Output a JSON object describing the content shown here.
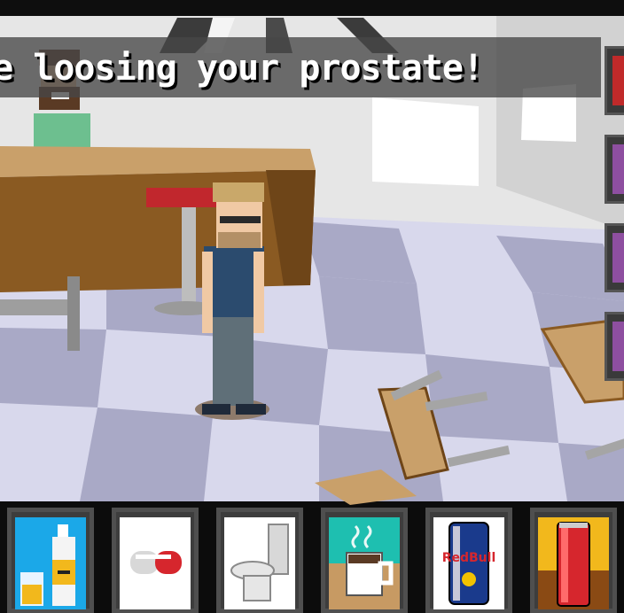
{
  "dialog": {
    "text": "re loosing your prostate!"
  },
  "side_buttons": [
    {
      "icon": "red-menu-icon",
      "color": "#c02a2a"
    },
    {
      "icon": "purple-menu-icon",
      "color": "#8e4fa0"
    },
    {
      "icon": "purple-menu-icon",
      "color": "#8e4fa0"
    },
    {
      "icon": "purple-menu-icon",
      "color": "#8e4fa0"
    }
  ],
  "inventory": [
    {
      "name": "water-and-drink",
      "icon": "water-bottle-icon"
    },
    {
      "name": "pill",
      "icon": "pill-icon"
    },
    {
      "name": "toilet",
      "icon": "toilet-icon"
    },
    {
      "name": "coffee",
      "icon": "coffee-mug-icon"
    },
    {
      "name": "energy-drink",
      "icon": "energy-drink-can-icon",
      "label": "RedBull"
    },
    {
      "name": "cola-can",
      "icon": "cola-can-icon"
    }
  ],
  "colors": {
    "floor_light": "#d8d8ec",
    "floor_dark": "#a7a7c3",
    "wall": "#e4e4e4",
    "counter": "#8a5a22"
  }
}
